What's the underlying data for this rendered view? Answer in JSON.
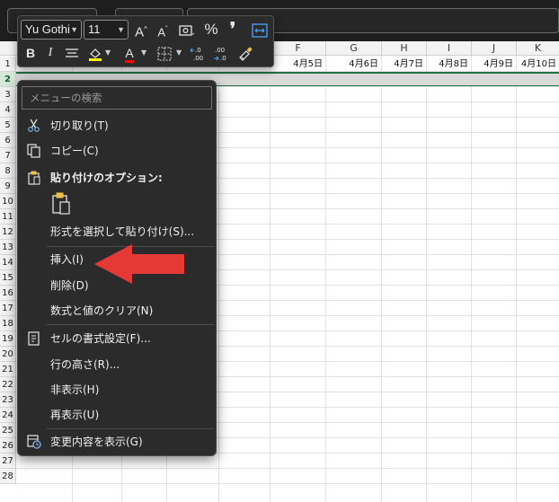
{
  "font_toolbar": {
    "font_name": "Yu Gothi",
    "font_size": "11",
    "increase_font_glyph": "A",
    "decrease_font_glyph": "A",
    "percent_glyph": "%",
    "comma_glyph": "❜",
    "bold_glyph": "B",
    "italic_glyph": "I",
    "font_color_glyph": "A",
    "decimal_increase_glyph": "←.0\n.00",
    "decimal_decrease_glyph": ".00\n→.0"
  },
  "grid": {
    "columns": [
      "F",
      "G",
      "H",
      "I",
      "J",
      "K"
    ],
    "rows": [
      "1",
      "2",
      "3",
      "4",
      "5",
      "6",
      "7",
      "8",
      "9",
      "10",
      "11",
      "12",
      "13",
      "14",
      "15",
      "16",
      "17",
      "18",
      "19",
      "20",
      "21",
      "22",
      "23",
      "24",
      "25",
      "26",
      "27",
      "28"
    ],
    "row1_dates": [
      "4月5日",
      "4月6日",
      "4月7日",
      "4月8日",
      "4月9日",
      "4月10日"
    ]
  },
  "context_menu": {
    "search_placeholder": "メニューの検索",
    "items": [
      {
        "label": "切り取り(T)"
      },
      {
        "label": "コピー(C)"
      },
      {
        "label": "貼り付けのオプション:"
      },
      {
        "label": "形式を選択して貼り付け(S)..."
      },
      {
        "label": "挿入(I)"
      },
      {
        "label": "削除(D)"
      },
      {
        "label": "数式と値のクリア(N)"
      },
      {
        "label": "セルの書式設定(F)..."
      },
      {
        "label": "行の高さ(R)..."
      },
      {
        "label": "非表示(H)"
      },
      {
        "label": "再表示(U)"
      },
      {
        "label": "変更内容を表示(G)"
      }
    ]
  },
  "colors": {
    "highlight_yellow": "#ffff00",
    "font_red": "#ff0000",
    "arrow_red": "#e53935",
    "selection_green": "#217346"
  }
}
